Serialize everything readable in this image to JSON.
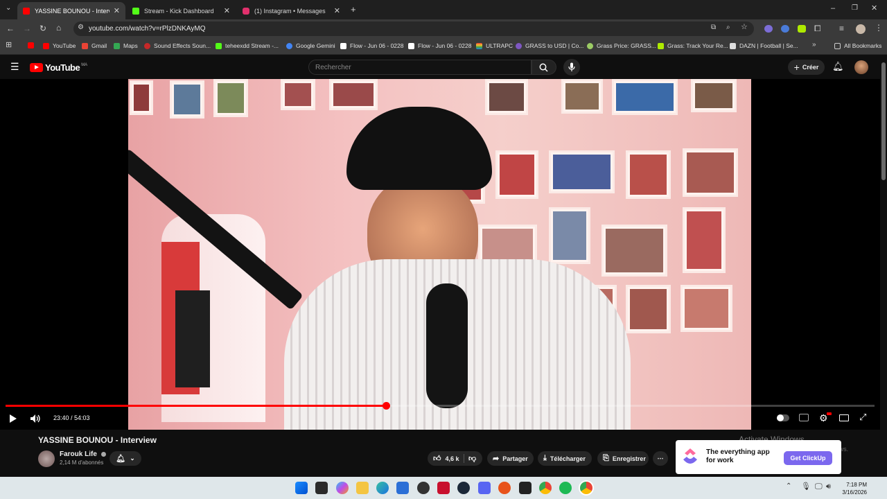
{
  "browser": {
    "tabs": [
      {
        "label": "YASSINE BOUNOU - Interview -",
        "favicon_color": "#ff0000",
        "active": true
      },
      {
        "label": "Stream - Kick Dashboard",
        "favicon_color": "#53fc18",
        "active": false
      },
      {
        "label": "(1) Instagram • Messages",
        "favicon_color": "#e1306c",
        "active": false
      }
    ],
    "url": "youtube.com/watch?v=rPlzDNKAyMQ",
    "bookmarks": [
      {
        "label": "",
        "color": "#ff0000"
      },
      {
        "label": "YouTube",
        "color": "#ff0000"
      },
      {
        "label": "Gmail",
        "color": "#ea4335"
      },
      {
        "label": "Maps",
        "color": "#34a853"
      },
      {
        "label": "Sound Effects Soun...",
        "color": "#c62828"
      },
      {
        "label": "teheexdd Stream -...",
        "color": "#53fc18"
      },
      {
        "label": "Google Gemini",
        "color": "#4285f4"
      },
      {
        "label": "Flow - Jun 06 - 0228",
        "color": "#ffffff"
      },
      {
        "label": "Flow - Jun 06 - 0228",
        "color": "#ffffff"
      },
      {
        "label": "ULTRAPC",
        "color": "#f9a825"
      },
      {
        "label": "GRASS to USD | Co...",
        "color": "#7e57c2"
      },
      {
        "label": "Grass Price: GRASS...",
        "color": "#9ccc65"
      },
      {
        "label": "Grass: Track Your Re...",
        "color": "#aeea00"
      },
      {
        "label": "DAZN | Football | Se...",
        "color": "#dddddd"
      }
    ],
    "all_bookmarks": "All Bookmarks"
  },
  "youtube": {
    "logo": "YouTube",
    "region": "MA",
    "search_placeholder": "Rechercher",
    "create_label": "Créer"
  },
  "player": {
    "current_time": "23:40",
    "duration": "54:03",
    "time_display": "23:40 / 54:03",
    "progress_fraction": 0.438
  },
  "video": {
    "title": "YASSINE BOUNOU - Interview",
    "channel": "Farouk Life",
    "subscribers": "2,14 M d'abonnés",
    "likes": "4,6 k",
    "share_label": "Partager",
    "download_label": "Télécharger",
    "save_label": "Enregistrer"
  },
  "ad": {
    "headline": "The everything app for work",
    "cta": "Get ClickUp"
  },
  "os": {
    "watermark_title": "Activate Windows",
    "watermark_sub": "Go to Settings to activate Windows.",
    "time": "7:18 PM",
    "date": "3/16/2026"
  },
  "colors": {
    "accent_red": "#ff0000",
    "youtube_bg": "#0f0f0f",
    "clickup_purple": "#7b68ee"
  }
}
